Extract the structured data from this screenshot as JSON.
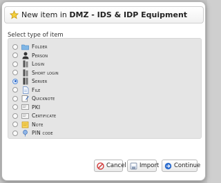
{
  "dialog": {
    "title_prefix": "New item in ",
    "title_bold": "DMZ - IDS & IDP Equipment",
    "title_icon": "star-icon"
  },
  "section_label": "Select type of item",
  "options": [
    {
      "label": "Folder",
      "icon": "folder-icon",
      "selected": false
    },
    {
      "label": "Person",
      "icon": "person-icon",
      "selected": false
    },
    {
      "label": "Login",
      "icon": "login-icon",
      "selected": false
    },
    {
      "label": "Short login",
      "icon": "short-login-icon",
      "selected": false
    },
    {
      "label": "Server",
      "icon": "server-icon",
      "selected": true
    },
    {
      "label": "File",
      "icon": "file-icon",
      "selected": false
    },
    {
      "label": "Quicknote",
      "icon": "quicknote-icon",
      "selected": false
    },
    {
      "label": "PKI",
      "icon": "pki-icon",
      "selected": false
    },
    {
      "label": "Certificate",
      "icon": "certificate-icon",
      "selected": false
    },
    {
      "label": "Note",
      "icon": "note-icon",
      "selected": false
    },
    {
      "label": "PIN code",
      "icon": "pin-code-icon",
      "selected": false
    }
  ],
  "buttons": {
    "cancel": "Cancel",
    "import": "Import",
    "continue": "Continue"
  }
}
